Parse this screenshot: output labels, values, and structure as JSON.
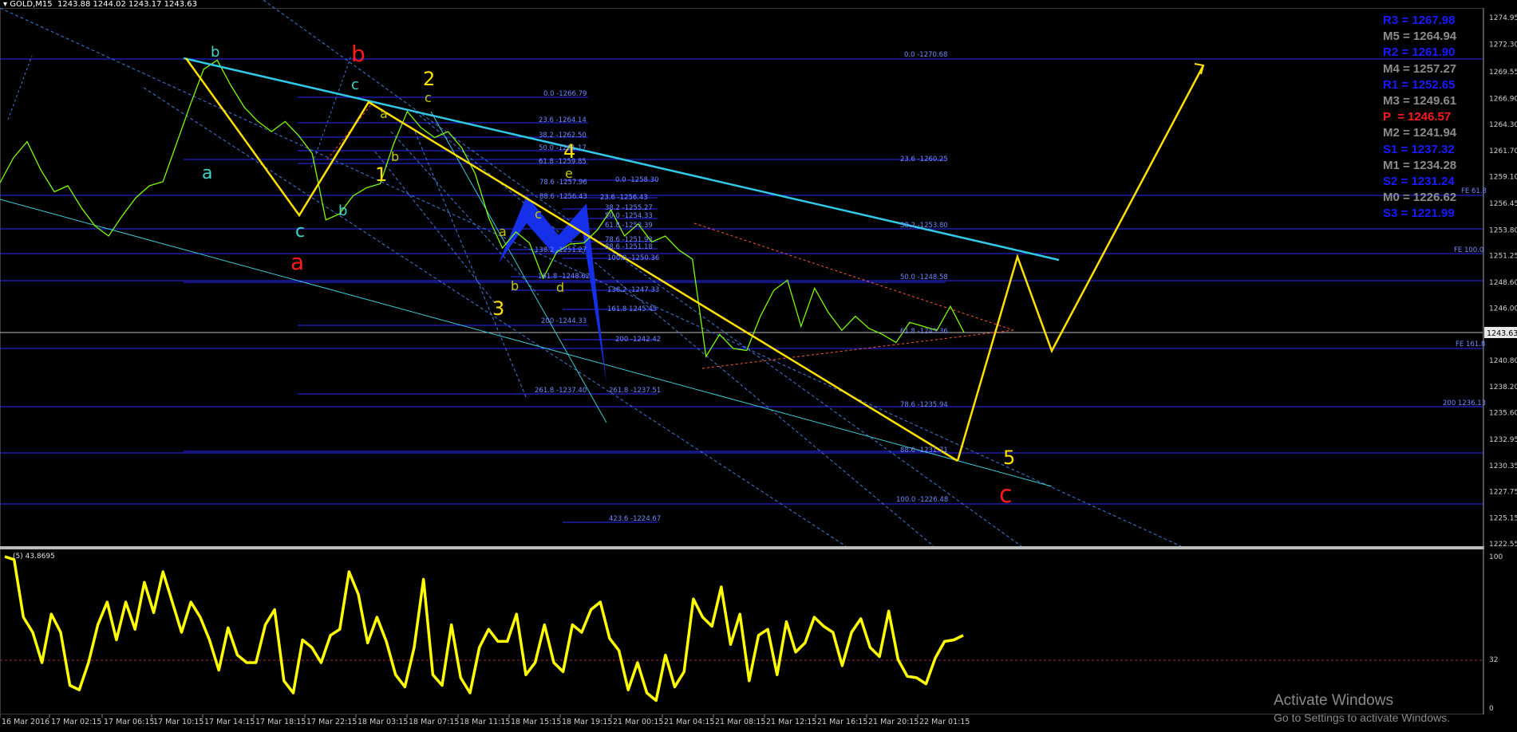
{
  "header": {
    "symbol_text": "GOLD,M15  1243.88 1244.02 1243.17 1243.63"
  },
  "pivots": [
    {
      "label": "R3 = 1267.98",
      "color": "#1a1aff"
    },
    {
      "label": "M5 = 1264.94",
      "color": "#8c8c8c"
    },
    {
      "label": "R2 = 1261.90",
      "color": "#1a1aff"
    },
    {
      "label": "M4 = 1257.27",
      "color": "#8c8c8c"
    },
    {
      "label": "R1 = 1252.65",
      "color": "#1a1aff"
    },
    {
      "label": "M3 = 1249.61",
      "color": "#8c8c8c"
    },
    {
      "label": "P  = 1246.57",
      "color": "#ff1a1a"
    },
    {
      "label": "M2 = 1241.94",
      "color": "#8c8c8c"
    },
    {
      "label": "S1 = 1237.32",
      "color": "#1a1aff"
    },
    {
      "label": "M1 = 1234.28",
      "color": "#8c8c8c"
    },
    {
      "label": "S2 = 1231.24",
      "color": "#1a1aff"
    },
    {
      "label": "M0 = 1226.62",
      "color": "#8c8c8c"
    },
    {
      "label": "S3 = 1221.99",
      "color": "#1a1aff"
    }
  ],
  "watermark": {
    "line1": "Activate Windows",
    "line2": "Go to Settings to activate Windows."
  },
  "chart_data": [
    {
      "type": "line",
      "symbol": "GOLD",
      "timeframe": "M15",
      "ohlc_header": [
        1243.88,
        1244.02,
        1243.17,
        1243.63
      ],
      "current_price": 1243.63,
      "ylim": [
        1222.55,
        1274.95
      ],
      "yticks": [
        1274.95,
        1272.3,
        1269.55,
        1266.9,
        1264.3,
        1261.7,
        1259.1,
        1256.45,
        1253.8,
        1251.25,
        1248.6,
        1246.0,
        1240.8,
        1238.2,
        1235.6,
        1232.95,
        1230.35,
        1227.75,
        1225.15,
        1222.55
      ],
      "xtick_labels": [
        "16 Mar 2016",
        "17 Mar 02:15",
        "17 Mar 06:15",
        "17 Mar 10:15",
        "17 Mar 14:15",
        "17 Mar 18:15",
        "17 Mar 22:15",
        "18 Mar 03:15",
        "18 Mar 07:15",
        "18 Mar 11:15",
        "18 Mar 15:15",
        "18 Mar 19:15",
        "21 Mar 00:15",
        "21 Mar 04:15",
        "21 Mar 08:15",
        "21 Mar 12:15",
        "21 Mar 16:15",
        "21 Mar 20:15",
        "22 Mar 01:15"
      ],
      "price_series": {
        "name": "",
        "color": "#7cfc00",
        "values": [
          1258.5,
          1261.0,
          1262.6,
          1259.8,
          1257.6,
          1258.2,
          1256.0,
          1254.2,
          1253.2,
          1255.2,
          1257.0,
          1258.2,
          1258.6,
          1262.4,
          1266.2,
          1269.8,
          1270.7,
          1268.2,
          1266.0,
          1264.6,
          1263.6,
          1264.6,
          1263.2,
          1261.4,
          1254.8,
          1255.4,
          1257.2,
          1258.0,
          1258.4,
          1262.4,
          1265.6,
          1264.0,
          1263.0,
          1263.6,
          1262.0,
          1259.4,
          1255.0,
          1252.0,
          1253.6,
          1252.5,
          1249.0,
          1251.6,
          1252.4,
          1252.5,
          1253.8,
          1255.8,
          1253.2,
          1254.4,
          1252.6,
          1253.2,
          1251.8,
          1250.9,
          1241.2,
          1243.4,
          1242.0,
          1241.8,
          1245.2,
          1247.8,
          1248.8,
          1244.2,
          1248.0,
          1245.6,
          1243.8,
          1245.2,
          1244.0,
          1243.4,
          1242.6,
          1244.6,
          1244.2,
          1243.8,
          1246.2,
          1243.6
        ]
      },
      "overlay_labels": [
        {
          "text": "a",
          "color": "#3dd6c8"
        },
        {
          "text": "b",
          "color": "#3dd6c8"
        },
        {
          "text": "c",
          "color": "#3dd6c8"
        },
        {
          "text": "b",
          "color": "#3dd6c8"
        },
        {
          "text": "c",
          "color": "#3dd6c8"
        },
        {
          "text": "b",
          "color": "#ff1a1a"
        },
        {
          "text": "a",
          "color": "#ff1a1a"
        },
        {
          "text": "c",
          "color": "#ff1a1a"
        },
        {
          "text": "2",
          "color": "#ffe000"
        },
        {
          "text": "1",
          "color": "#ffe000"
        },
        {
          "text": "3",
          "color": "#ffe000"
        },
        {
          "text": "4",
          "color": "#ffe000"
        },
        {
          "text": "5",
          "color": "#ffe000"
        },
        {
          "text": "a",
          "color": "#c8c800"
        },
        {
          "text": "b",
          "color": "#c8c800"
        },
        {
          "text": "c",
          "color": "#c8c800"
        },
        {
          "text": "a",
          "color": "#c8c800"
        },
        {
          "text": "b",
          "color": "#c8c800"
        },
        {
          "text": "c",
          "color": "#c8c800"
        },
        {
          "text": "d",
          "color": "#c8c800"
        },
        {
          "text": "e",
          "color": "#c8c800"
        }
      ],
      "fib_labels": [
        "0.0 -1270.68",
        "0.0 -1266.79",
        "23.6 -1264.14",
        "38.2 -1262.50",
        "50.0 -1261.17",
        "61.8 -1259.85",
        "23.6 -1260.25",
        "0.0 -1258.30",
        "78.6 -1257.96",
        "88.6 -1256.43",
        "23.6 -1256.43",
        "38.2 -1255.27",
        "50.0 -1254.33",
        "38.2 -1253.80",
        "61.8 -1253.39",
        "78.6 -1251.93",
        "88.6 -1251.18",
        "138.2 -1251.27",
        "100.0 -1250.36",
        "161.8 -1248.62",
        "50.0 -1248.58",
        "138.2 -1247.33",
        "161.8 1245.45",
        "61.8 -1243.36",
        "200 -1244.33",
        "200 -1242.42",
        "261.8 -1237.40",
        "261.8 -1237.51",
        "78.6 -1235.94",
        "88.6 -1231.71",
        "100.0 -1226.48",
        "423.6 -1224.67",
        "FE 61.8",
        "FE 100.0",
        "FE 161.8",
        "200 1236.13"
      ]
    },
    {
      "type": "line",
      "indicator": "(5) 43.8695",
      "ylim": [
        0,
        100
      ],
      "yticks": [
        100,
        32,
        0
      ],
      "level_line": 32,
      "series": [
        {
          "name": "",
          "color": "#ffff00",
          "values": [
            100,
            98,
            60,
            50,
            30,
            62,
            50,
            15,
            12,
            30,
            55,
            70,
            45,
            70,
            52,
            83,
            63,
            90,
            70,
            50,
            70,
            60,
            45,
            25,
            53,
            35,
            30,
            30,
            55,
            65,
            18,
            10,
            45,
            40,
            30,
            48,
            52,
            90,
            75,
            43,
            60,
            44,
            22,
            14,
            40,
            85,
            22,
            15,
            55,
            20,
            10,
            40,
            52,
            44,
            44,
            62,
            22,
            30,
            55,
            30,
            24,
            55,
            50,
            65,
            70,
            46,
            38,
            12,
            30,
            10,
            5,
            35,
            14,
            24,
            72,
            60,
            54,
            80,
            42,
            62,
            18,
            48,
            52,
            22,
            57,
            37,
            43,
            60,
            54,
            50,
            28,
            50,
            59,
            40,
            34,
            64,
            32,
            21,
            20,
            16,
            33,
            44,
            45,
            48
          ]
        }
      ]
    }
  ]
}
